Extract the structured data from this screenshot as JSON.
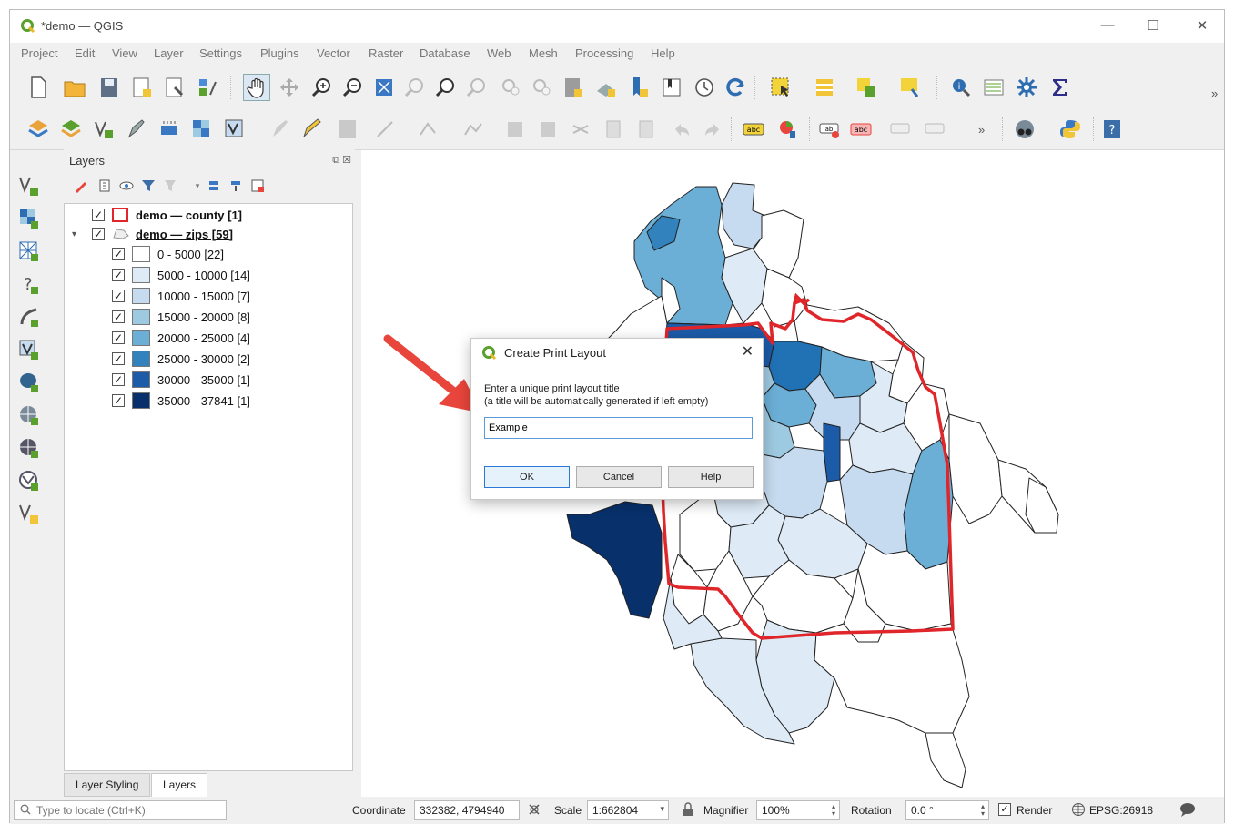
{
  "window": {
    "title": "*demo — QGIS",
    "minimize": "—",
    "maximize": "☐",
    "close": "✕"
  },
  "menu": [
    "Project",
    "Edit",
    "View",
    "Layer",
    "Settings",
    "Plugins",
    "Vector",
    "Raster",
    "Database",
    "Web",
    "Mesh",
    "Processing",
    "Help"
  ],
  "layers_panel": {
    "title": "Layers",
    "float_btn": "⧉",
    "close_btn": "☒",
    "layers": [
      {
        "label": "demo — county [1]",
        "checked": "✓"
      },
      {
        "label": "demo — zips [59]",
        "checked": "✓",
        "expand": "▾"
      }
    ],
    "classes": [
      {
        "label": "0 - 5000 [22]",
        "color": "#ffffff",
        "checked": "✓"
      },
      {
        "label": "5000 - 10000 [14]",
        "color": "#deebf7",
        "checked": "✓"
      },
      {
        "label": "10000 - 15000 [7]",
        "color": "#c6dbef",
        "checked": "✓"
      },
      {
        "label": "15000 - 20000 [8]",
        "color": "#9ecae1",
        "checked": "✓"
      },
      {
        "label": "20000 - 25000 [4]",
        "color": "#6baed6",
        "checked": "✓"
      },
      {
        "label": "25000 - 30000 [2]",
        "color": "#3182bd",
        "checked": "✓"
      },
      {
        "label": "30000 - 35000 [1]",
        "color": "#1c5ba8",
        "checked": "✓"
      },
      {
        "label": "35000 - 37841 [1]",
        "color": "#08306b",
        "checked": "✓"
      }
    ],
    "tabs": [
      "Layer Styling",
      "Layers"
    ]
  },
  "dialog": {
    "title": "Create Print Layout",
    "close": "✕",
    "prompt_line1": "Enter a unique print layout title",
    "prompt_line2": "(a title will be automatically generated if left empty)",
    "input_value": "Example",
    "ok": "OK",
    "cancel": "Cancel",
    "help": "Help"
  },
  "statusbar": {
    "locator_placeholder": "Type to locate (Ctrl+K)",
    "coordinate_label": "Coordinate",
    "coordinate_value": "332382, 4794940",
    "scale_label": "Scale",
    "scale_value": "1:662804",
    "magnifier_label": "Magnifier",
    "magnifier_value": "100%",
    "rotation_label": "Rotation",
    "rotation_value": "0.0 °",
    "render_label": "Render",
    "render_checked": "✓",
    "crs": "EPSG:26918",
    "chevron": "»"
  },
  "colors": {
    "county_outline": "#e0262a",
    "accent": "#2b78d6",
    "arrow": "#e8453c"
  }
}
